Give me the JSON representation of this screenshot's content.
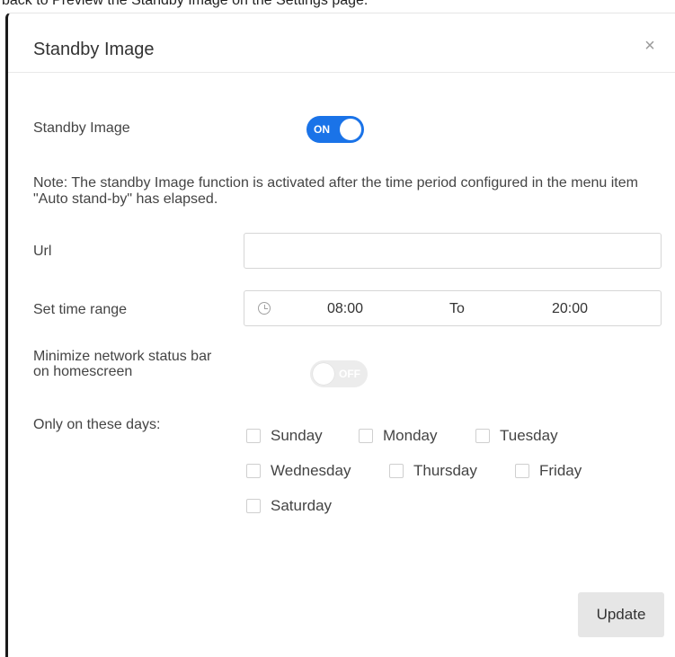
{
  "background_caption": "back to Preview the Standby Image on the Settings page.",
  "dialog": {
    "title": "Standby Image",
    "close_icon": "close-icon"
  },
  "standby_image": {
    "label": "Standby Image",
    "toggle_state": "ON"
  },
  "note": "Note: The standby Image function is activated after the time period configured in the menu item \"Auto stand-by\" has elapsed.",
  "url": {
    "label": "Url",
    "value": "",
    "placeholder": ""
  },
  "time_range": {
    "label": "Set time range",
    "start": "08:00",
    "separator": "To",
    "end": "20:00",
    "icon": "clock-icon"
  },
  "minimize_status_bar": {
    "label_line1": "Minimize network status bar",
    "label_line2": "on homescreen",
    "toggle_state": "OFF"
  },
  "days": {
    "label": "Only on these days:",
    "items": [
      "Sunday",
      "Monday",
      "Tuesday",
      "Wednesday",
      "Thursday",
      "Friday",
      "Saturday"
    ],
    "checked": [
      false,
      false,
      false,
      false,
      false,
      false,
      false
    ]
  },
  "update_button": "Update",
  "colors": {
    "accent": "#1a73e8",
    "toggle_off": "#ececec",
    "button_bg": "#e6e6e6",
    "text": "#444444"
  }
}
